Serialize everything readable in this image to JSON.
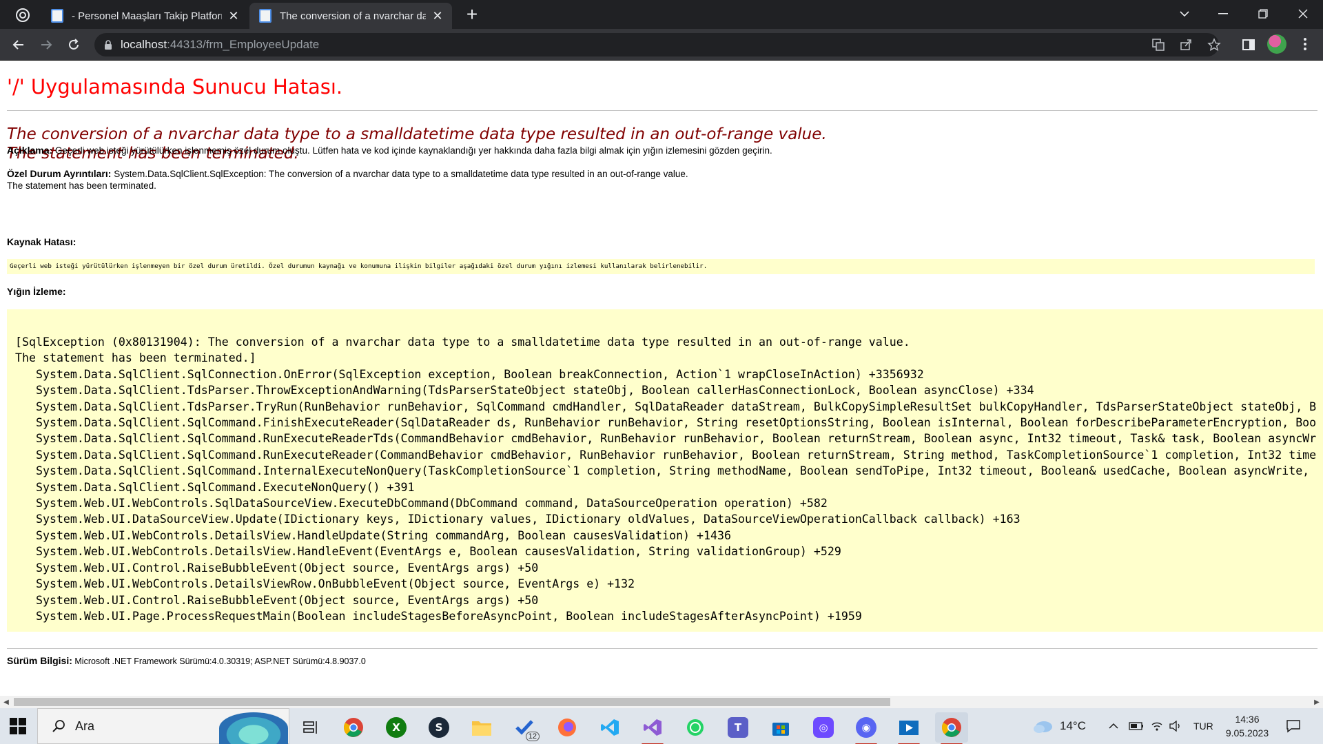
{
  "browser": {
    "tabs": [
      {
        "title": "- Personel Maaşları Takip Platform",
        "active": false
      },
      {
        "title": "The conversion of a nvarchar dat",
        "active": true
      }
    ],
    "url_host": "localhost",
    "url_rest": ":44313/frm_EmployeeUpdate"
  },
  "page": {
    "heading": "'/' Uygulamasında Sunucu Hatası.",
    "error_line1": "The conversion of a nvarchar data type to a smalldatetime data type resulted in an out-of-range value.",
    "error_line2": "The statement has been terminated.",
    "description_label": "Açıklama:",
    "description_text": " Geçerli web isteği yürütülürken işlenmemiş özel durum oluştu. Lütfen hata ve kod içinde kaynaklandığı yer hakkında daha fazla bilgi almak için yığın izlemesini gözden geçirin.",
    "exception_label": "Özel Durum Ayrıntıları:",
    "exception_text": " System.Data.SqlClient.SqlException: The conversion of a nvarchar data type to a smalldatetime data type resulted in an out-of-range value.",
    "exception_text2": "The statement has been terminated.",
    "source_label": "Kaynak Hatası:",
    "source_text": "Geçerli web isteği yürütülürken işlenmeyen bir özel durum üretildi. Özel durumun kaynağı ve konumuna ilişkin bilgiler aşağıdaki özel durum yığını izlemesi kullanılarak belirlenebilir.",
    "stack_label": "Yığın İzleme:",
    "stack_lines": [
      "[SqlException (0x80131904): The conversion of a nvarchar data type to a smalldatetime data type resulted in an out-of-range value.",
      "The statement has been terminated.]",
      "   System.Data.SqlClient.SqlConnection.OnError(SqlException exception, Boolean breakConnection, Action`1 wrapCloseInAction) +3356932",
      "   System.Data.SqlClient.TdsParser.ThrowExceptionAndWarning(TdsParserStateObject stateObj, Boolean callerHasConnectionLock, Boolean asyncClose) +334",
      "   System.Data.SqlClient.TdsParser.TryRun(RunBehavior runBehavior, SqlCommand cmdHandler, SqlDataReader dataStream, BulkCopySimpleResultSet bulkCopyHandler, TdsParserStateObject stateObj, B",
      "   System.Data.SqlClient.SqlCommand.FinishExecuteReader(SqlDataReader ds, RunBehavior runBehavior, String resetOptionsString, Boolean isInternal, Boolean forDescribeParameterEncryption, Boo",
      "   System.Data.SqlClient.SqlCommand.RunExecuteReaderTds(CommandBehavior cmdBehavior, RunBehavior runBehavior, Boolean returnStream, Boolean async, Int32 timeout, Task& task, Boolean asyncWr",
      "   System.Data.SqlClient.SqlCommand.RunExecuteReader(CommandBehavior cmdBehavior, RunBehavior runBehavior, Boolean returnStream, String method, TaskCompletionSource`1 completion, Int32 time",
      "   System.Data.SqlClient.SqlCommand.InternalExecuteNonQuery(TaskCompletionSource`1 completion, String methodName, Boolean sendToPipe, Int32 timeout, Boolean& usedCache, Boolean asyncWrite,",
      "   System.Data.SqlClient.SqlCommand.ExecuteNonQuery() +391",
      "   System.Web.UI.WebControls.SqlDataSourceView.ExecuteDbCommand(DbCommand command, DataSourceOperation operation) +582",
      "   System.Web.UI.DataSourceView.Update(IDictionary keys, IDictionary values, IDictionary oldValues, DataSourceViewOperationCallback callback) +163",
      "   System.Web.UI.WebControls.DetailsView.HandleUpdate(String commandArg, Boolean causesValidation) +1436",
      "   System.Web.UI.WebControls.DetailsView.HandleEvent(EventArgs e, Boolean causesValidation, String validationGroup) +529",
      "   System.Web.UI.Control.RaiseBubbleEvent(Object source, EventArgs args) +50",
      "   System.Web.UI.WebControls.DetailsViewRow.OnBubbleEvent(Object source, EventArgs e) +132",
      "   System.Web.UI.Control.RaiseBubbleEvent(Object source, EventArgs args) +50",
      "   System.Web.UI.Page.ProcessRequestMain(Boolean includeStagesBeforeAsyncPoint, Boolean includeStagesAfterAsyncPoint) +1959"
    ],
    "version_label": "Sürüm Bilgisi:",
    "version_text": " Microsoft .NET Framework Sürümü:4.0.30319; ASP.NET Sürümü:4.8.9037.0"
  },
  "taskbar": {
    "search_placeholder": "Ara",
    "todo_badge": "12",
    "weather": "14°C",
    "language": "TUR",
    "time": "14:36",
    "date": "9.05.2023"
  },
  "colors": {
    "heading": "#ff0000",
    "error_message": "#800000",
    "highlight_bg": "#ffffcc"
  }
}
